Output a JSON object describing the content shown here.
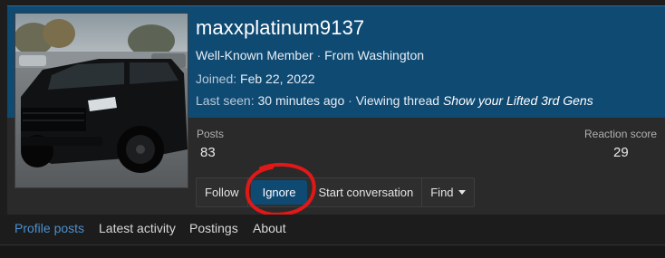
{
  "profile": {
    "username": "maxxplatinum9137",
    "title": "Well-Known Member",
    "separator": "·",
    "location": "From Washington",
    "joined_label": "Joined:",
    "joined_value": "Feb 22, 2022",
    "last_seen_label": "Last seen:",
    "last_seen_value": "30 minutes ago",
    "activity_text": "Viewing thread",
    "activity_thread": "Show your Lifted 3rd Gens",
    "avatar_icon": "suv-photo-avatar"
  },
  "stats": {
    "posts_label": "Posts",
    "posts_value": "83",
    "reaction_label": "Reaction score",
    "reaction_value": "29"
  },
  "actions": {
    "follow": "Follow",
    "ignore": "Ignore",
    "start_conversation": "Start conversation",
    "find": "Find"
  },
  "tabs": [
    "Profile posts",
    "Latest activity",
    "Postings",
    "About"
  ],
  "colors": {
    "banner": "#0f4a73",
    "active_tab": "#4a8fcf",
    "annotation": "#e01818"
  }
}
